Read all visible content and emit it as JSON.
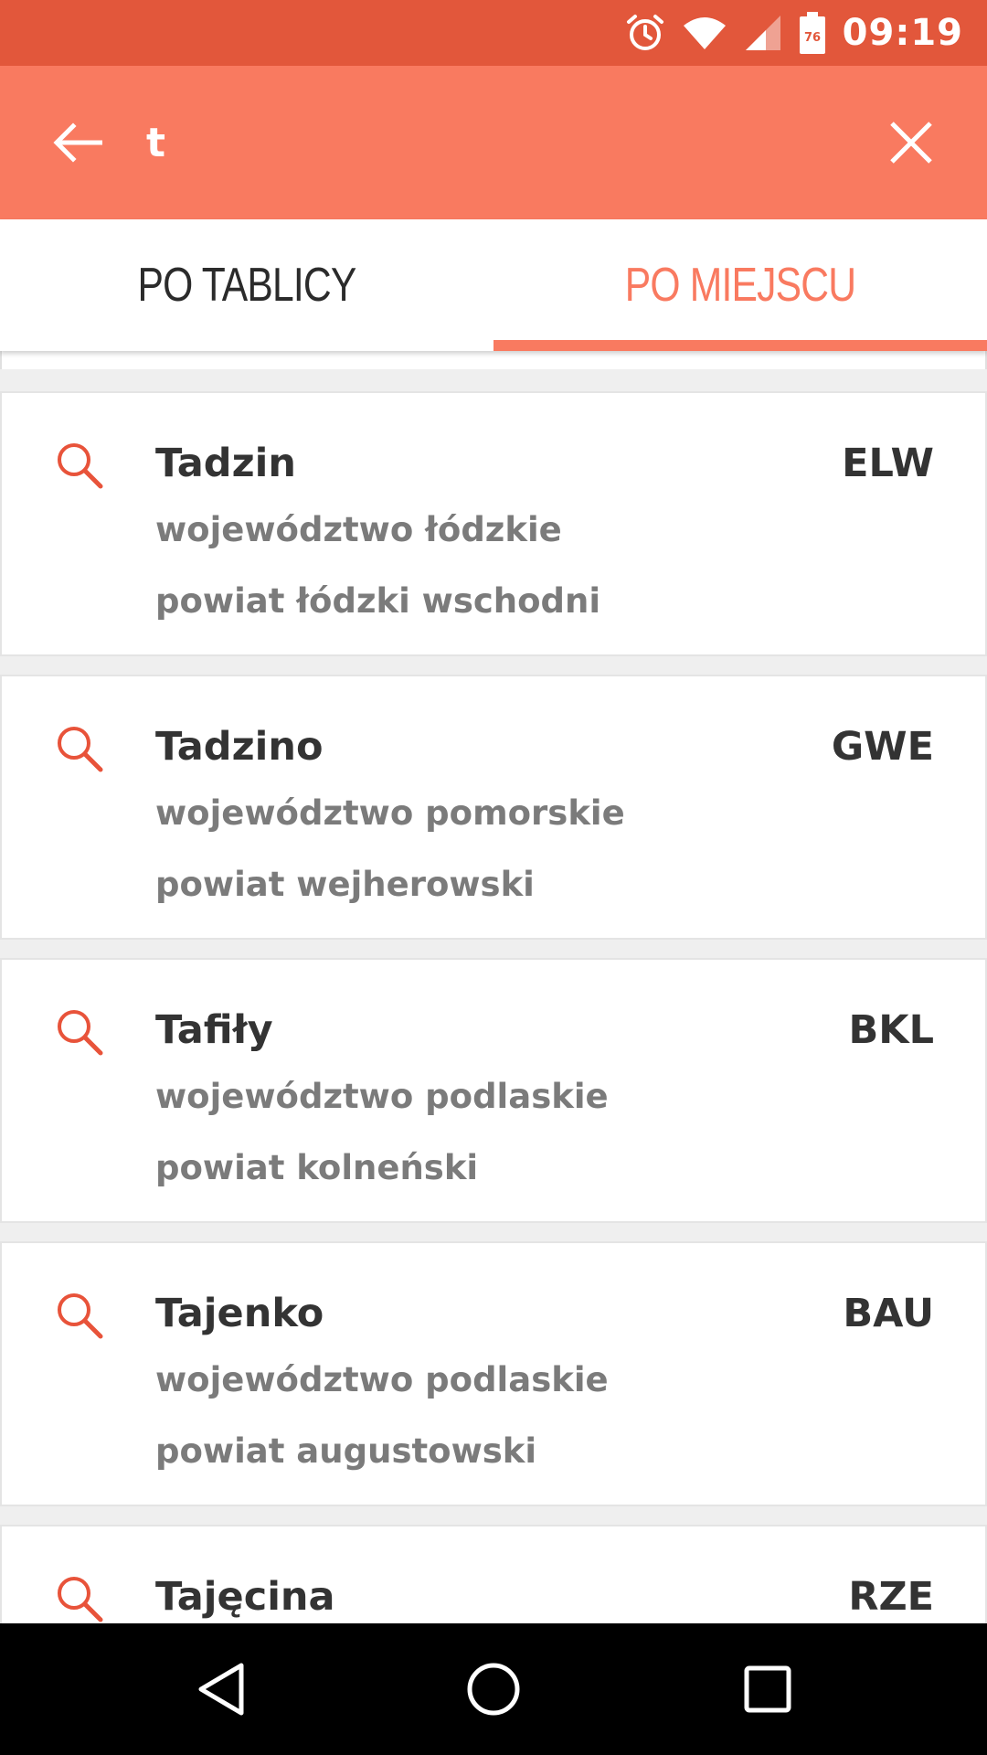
{
  "status_bar": {
    "time": "09:19",
    "battery_level": "76",
    "icons": [
      "alarm-icon",
      "wifi-icon",
      "cell-signal-icon",
      "battery-icon"
    ]
  },
  "search": {
    "query": "t",
    "back_icon": "arrow-left-icon",
    "clear_icon": "close-icon"
  },
  "tabs": [
    {
      "label": "PO TABLICY",
      "active": false
    },
    {
      "label": "PO MIEJSCU",
      "active": true
    }
  ],
  "results": [
    {
      "name": "Tadzin",
      "code": "ELW",
      "voivodeship": "województwo łódzkie",
      "county": "powiat łódzki wschodni"
    },
    {
      "name": "Tadzino",
      "code": "GWE",
      "voivodeship": "województwo pomorskie",
      "county": "powiat wejherowski"
    },
    {
      "name": "Tafiły",
      "code": "BKL",
      "voivodeship": "województwo podlaskie",
      "county": "powiat kolneński"
    },
    {
      "name": "Tajenko",
      "code": "BAU",
      "voivodeship": "województwo podlaskie",
      "county": "powiat augustowski"
    },
    {
      "name": "Tajęcina",
      "code": "RZE",
      "voivodeship": "",
      "county": ""
    }
  ],
  "nav": [
    "back-triangle-icon",
    "home-circle-icon",
    "recents-square-icon"
  ],
  "colors": {
    "status_bar": "#e2573b",
    "accent": "#f97a60",
    "title_text": "#333333",
    "secondary_text": "#7b7b7b"
  }
}
